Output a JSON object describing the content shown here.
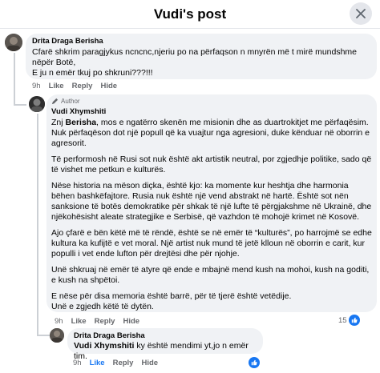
{
  "header": {
    "title": "Vudi's post"
  },
  "comment1": {
    "author": "Drita Draga Berisha",
    "lines": [
      "Cfarë shkrim paragjykus ncncnc,njeriu po na përfaqson n mnyrën më t mirë mundshme",
      "nëpër Botë,",
      "E ju n emër tkuj po shkruni???!!!"
    ],
    "time": "9h",
    "like": "Like",
    "reply": "Reply",
    "hide": "Hide"
  },
  "comment2": {
    "badge": "Author",
    "author": "Vudi Xhymshiti",
    "p1_mention": "Berisha",
    "p1_prefix": "Znj",
    "p1_rest": ", mos e ngatërro skenën me misionin dhe as duartrokitjet me përfaqësim. Nuk përfaqëson dot një popull që ka vuajtur nga agresioni, duke kënduar në oborrin e agresorit.",
    "p2": "Të performosh në Rusi sot nuk është akt artistik neutral, por zgjedhje politike, sado që të vishet me petkun e kulturës.",
    "p3": "Nëse historia na mëson diçka, është kjo: ka momente kur heshtja dhe harmonia bëhen bashkëfajtore. Rusia nuk është një vend abstrakt në hartë. Është sot nën sanksione të botës demokratike për shkak të një lufte të përgjakshme në Ukrainë, dhe njëkohësisht aleate strategjike e Serbisë, që vazhdon të mohojë krimet në Kosovë.",
    "p4": "Ajo çfarë e bën këtë më të rëndë, është se në emër të “kulturës”, po harrojmë se edhe kultura ka kufijtë e vet moral. Një artist nuk mund të jetë klloun në oborrin e carit, kur populli i vet ende lufton për drejtësi dhe për njohje.",
    "p5": "Unë shkruaj në emër të atyre që ende e mbajnë mend kush na mohoi, kush na goditi, e kush na shpëtoi.",
    "p6a": "E nëse për disa memoria është barrë, për të tjerë është vetëdije.",
    "p6b": "Unë e zgjedh këtë të dytën.",
    "time": "9h",
    "like": "Like",
    "reply": "Reply",
    "hide": "Hide",
    "reactions": "15"
  },
  "comment3": {
    "author": "Drita Draga Berisha",
    "mention": "Vudi Xhymshiti",
    "text": " ky është mendimi yt,jo n emër tim.",
    "time": "9h",
    "like": "Like",
    "reply": "Reply",
    "hide": "Hide"
  },
  "colors": {
    "accent": "#1877f2",
    "bubble": "#f0f2f5",
    "muted": "#65676b"
  }
}
